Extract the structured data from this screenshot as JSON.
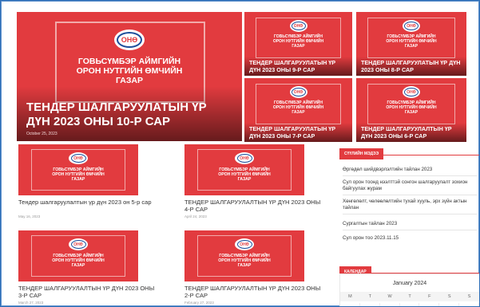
{
  "org_text": [
    "ГОВЬСҮМБЭР АЙМГИЙН",
    "ОРОН НУТГИЙН ӨМЧИЙН",
    "ГАЗАР"
  ],
  "hero": {
    "title": "ТЕНДЕР ШАЛГАРУУЛАТЫН ҮР ДҮН 2023 ОНЫ 10-Р САР",
    "date": "October 25, 2023"
  },
  "grid": [
    {
      "title": "ТЕНДЕР ШАЛГАРУУЛАТЫН ҮР ДҮН 2023 ОНЫ 9-Р САР"
    },
    {
      "title": "ТЕНДЕР ШАЛГАРУУЛАТЫН ҮР ДҮН 2023 ОНЫ 8-Р САР"
    },
    {
      "title": "ТЕНДЕР ШАЛГАРУУЛАТЫН ҮР ДҮН 2023 ОНЫ 7-Р САР"
    },
    {
      "title": "ТЕНДЕР ШАЛГАРУУЛАЛТЫН ҮР ДҮН 2023 ОНЫ 6-Р САР"
    }
  ],
  "posts": [
    {
      "title": "Тендер шалгаруулалтын үр дүн 2023 он 5-р сар",
      "date": "May 16, 2023"
    },
    {
      "title": "ТЕНДЕР ШАЛГАРУУЛАЛТЫН ҮР ДҮН 2023 ОНЫ 4-Р САР",
      "date": "April 24, 2023"
    },
    {
      "title": "ТЕНДЕР ШАЛГАРУУЛАЛТЫН ҮР ДҮН 2023 ОНЫ 3-Р САР",
      "date": "March 27, 2023"
    },
    {
      "title": "ТЕНДЕР ШАЛГАРУУЛАЛТЫН ҮР ДҮН 2023 ОНЫ 2-Р САР",
      "date": "February 27, 2023"
    }
  ],
  "sidebar": {
    "recent_heading": "СҮҮЛИЙН МЭДЭЭ",
    "recent_items": [
      "Өргөдөл шийдвэрлэлтийн тайлан 2023",
      "Сул орон тоонд нээлттэй сонгон шалгаруулалт зохион байгуулах журам",
      "Хөнгөлөлт, чөлөөлөлтийн тухай хууль, эрх зүйн актын тайлан",
      "Сургалтын тайлан 2023",
      "Сул орон тоо 2023.11.15"
    ],
    "calendar_heading": "КАЛЕНДАР",
    "calendar_month": "January 2024",
    "weekdays": [
      "M",
      "T",
      "W",
      "T",
      "F",
      "S",
      "S"
    ]
  },
  "colors": {
    "brand_red": "#e23b3f",
    "logo_blue": "#1d4f9c"
  }
}
